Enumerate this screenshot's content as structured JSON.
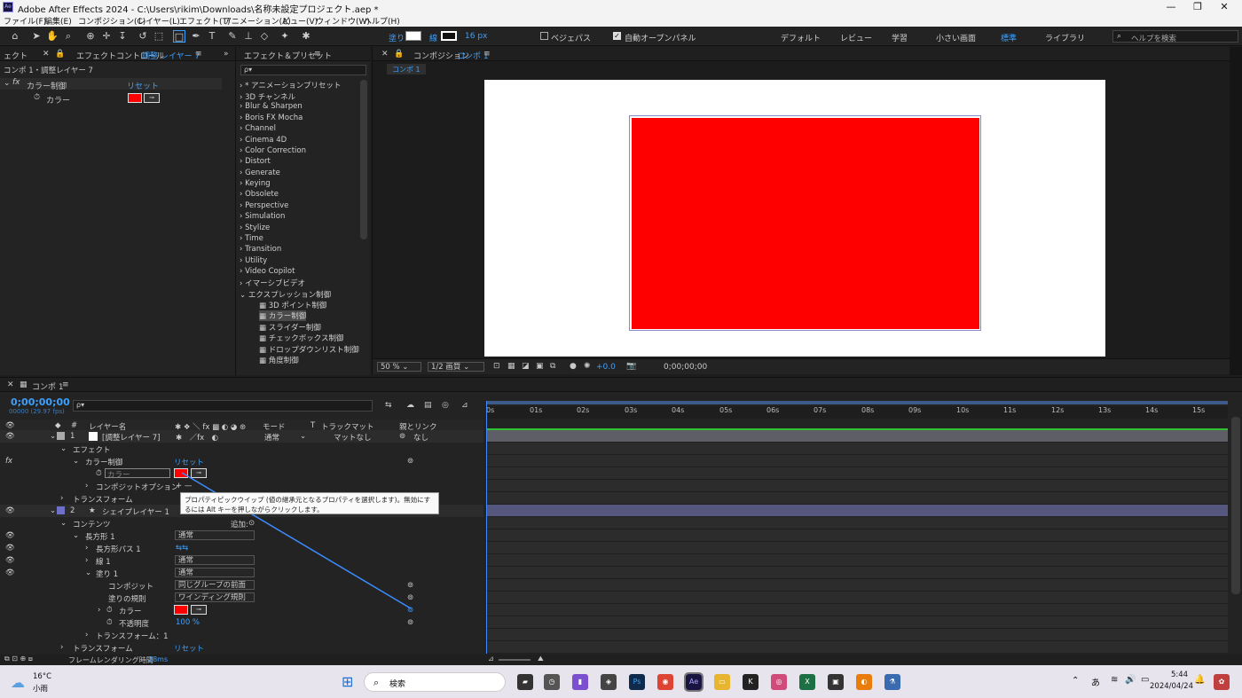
{
  "window": {
    "title": "Adobe After Effects 2024 - C:\\Users\\rikim\\Downloads\\名称未設定プロジェクト.aep *",
    "logo": "Ae"
  },
  "menu": [
    "ファイル(F)",
    "編集(E)",
    "コンポジション(C)",
    "レイヤー(L)",
    "エフェクト(T)",
    "アニメーション(A)",
    "ビュー(V)",
    "ウィンドウ(W)",
    "ヘルプ(H)"
  ],
  "toolbar": {
    "fill_label": "塗り",
    "stroke_label": "線",
    "stroke_width": "16 px",
    "bezier_label": "ベジェパス",
    "auto_open_label": "自動オープンパネル",
    "workspaces": [
      "デフォルト",
      "レビュー",
      "学習",
      "小さい画面",
      "標準",
      "ライブラリ"
    ],
    "help_placeholder": "ヘルプを検索"
  },
  "effect_controls": {
    "tab_prefix": "ェクト",
    "tab_label": "エフェクトコントロール",
    "tab_target": "調整 レイヤー 7",
    "subtitle": "コンポ 1・調整レイヤー 7",
    "effect_name": "カラー制御",
    "reset": "リセット",
    "prop_label": "カラー",
    "fx": "fx"
  },
  "effects_presets": {
    "title": "エフェクト＆プリセット",
    "search_placeholder": "ρ▾",
    "items": [
      "* アニメーションプリセット",
      "3D チャンネル",
      "Blur & Sharpen",
      "Boris FX Mocha",
      "Channel",
      "Cinema 4D",
      "Color Correction",
      "Distort",
      "Generate",
      "Keying",
      "Obsolete",
      "Perspective",
      "Simulation",
      "Stylize",
      "Time",
      "Transition",
      "Utility",
      "Video Copilot",
      "イマーシブビデオ",
      "エクスプレッション制御"
    ],
    "sub_items": [
      "3D ポイント制御",
      "カラー制御",
      "スライダー制御",
      "チェックボックス制御",
      "ドロップダウンリスト制御",
      "角度制御"
    ],
    "selected_sub": "カラー制御"
  },
  "composition": {
    "tab_label": "コンポジション",
    "tab_name": "コンポ 1",
    "subtab": "コンポ 1",
    "zoom": "50 %",
    "quality": "1/2 画質",
    "exposure": "+0.0",
    "timecode": "0;00;00;00",
    "rect_color": "#ff0000"
  },
  "timeline": {
    "tab": "コンポ 1",
    "timecode": "0;00;00;00",
    "fps": "00000 (29.97 fps)",
    "search_placeholder": "ρ▾",
    "col_name": "レイヤー名",
    "col_mode": "モード",
    "col_t": "T",
    "col_track": "トラックマット",
    "col_parent": "親とリンク",
    "ruler": [
      "0s",
      "01s",
      "02s",
      "03s",
      "04s",
      "05s",
      "06s",
      "07s",
      "08s",
      "09s",
      "10s",
      "11s",
      "12s",
      "13s",
      "14s",
      "15s"
    ],
    "rows": {
      "layer1_num": "1",
      "layer1_name": "[調整レイヤー 7]",
      "layer1_mode": "通常",
      "layer1_track": "マットなし",
      "layer1_parent": "なし",
      "effect": "エフェクト",
      "color_ctrl": "カラー制御",
      "reset": "リセット",
      "color_field": "カラー",
      "composite": "コンポジットオプション",
      "composite_val": "+ —",
      "transform": "トランスフォーム",
      "layer2_num": "2",
      "layer2_name": "シェイプレイヤー 1",
      "contents": "コンテンツ",
      "add": "追加:",
      "rect": "長方形 1",
      "rect_mode": "通常",
      "rect_path": "長方形パス 1",
      "stroke": "線 1",
      "stroke_mode": "通常",
      "fill": "塗り 1",
      "fill_mode": "通常",
      "comp": "コンポジット",
      "comp_val": "同じグループの前面",
      "rule": "塗りの規則",
      "rule_val": "ワインディング規則",
      "color": "カラー",
      "opacity": "不透明度",
      "opacity_val": "100 %",
      "transform_sub": "トランスフォーム：1",
      "transform2": "トランスフォーム",
      "reset2": "リセット"
    },
    "tooltip": "プロパティピックウイップ (値の継承元となるプロパティを選択します)。無効にするには Alt キーを押しながらクリックします。",
    "footer_label": "フレームレンダリング時間",
    "footer_value": "28ms"
  },
  "taskbar": {
    "weather_temp": "16°C",
    "weather_desc": "小雨",
    "search": "検索",
    "ime": "あ",
    "time": "5:44",
    "date": "2024/04/24"
  }
}
